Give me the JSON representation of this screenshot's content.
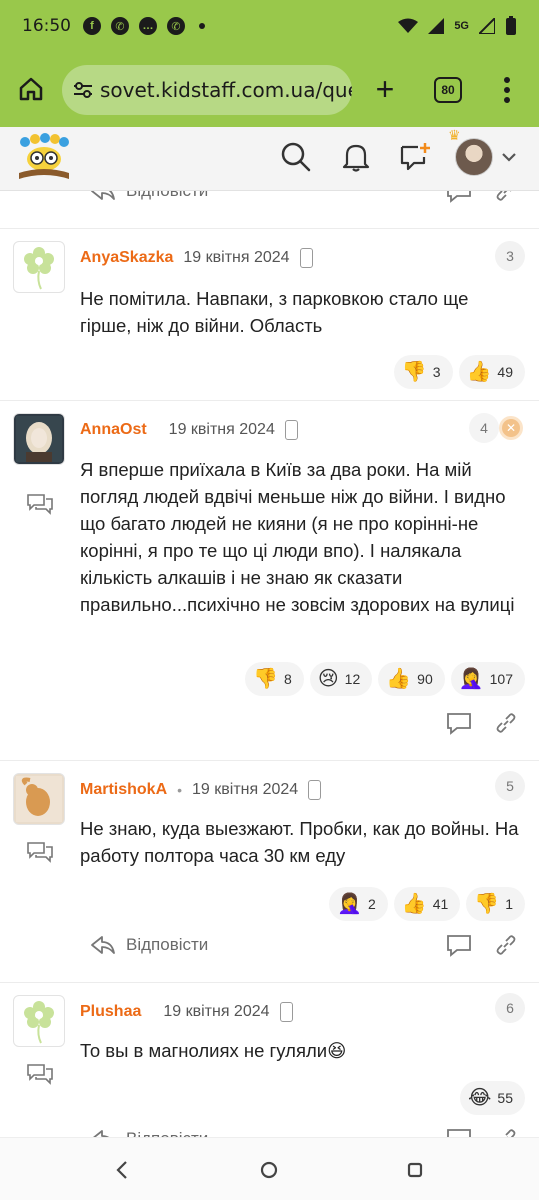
{
  "status": {
    "time": "16:50",
    "icons": [
      "facebook-icon",
      "whatsapp-icon",
      "chat-icon",
      "viber-icon"
    ],
    "network": "5G"
  },
  "browser": {
    "url": "sovet.kidstaff.com.ua/ques",
    "tab_count": "80"
  },
  "colors": {
    "chrome": "#99c84b",
    "username": "#ec6a16"
  },
  "reply_label": "Відповісти",
  "comments": [
    {
      "username": "AnyaSkazka",
      "date": "19 квітня 2024",
      "number": "3",
      "text": "Не помітила. Навпаки, з парковкою стало ще гірше, ніж до війни. Область",
      "reactions": [
        {
          "emoji": "👎",
          "count": "3"
        },
        {
          "emoji": "👍",
          "count": "49"
        }
      ]
    },
    {
      "username": "AnnaOst",
      "date": "19 квітня 2024",
      "number": "4",
      "text": "Я вперше приїхала в Київ за два роки. На мій погляд людей вдвічі меньше ніж до війни. І видно що багато людей не кияни (я не про корінні-не корінні, я про те що ці люди впо). І налякала кількість алкашів і не знаю як сказати правильно...психічно не зовсім здорових на вулиці",
      "reactions": [
        {
          "emoji": "👎",
          "count": "8"
        },
        {
          "emoji": "😢",
          "count": "12"
        },
        {
          "emoji": "👍",
          "count": "90"
        },
        {
          "emoji": "🤦‍♀️",
          "count": "107"
        }
      ]
    },
    {
      "username": "MartishokA",
      "date": "19 квітня 2024",
      "number": "5",
      "text": "Не знаю, куда выезжают. Пробки, как до войны. На работу полтора часа 30 км еду",
      "reactions": [
        {
          "emoji": "🤦‍♀️",
          "count": "2"
        },
        {
          "emoji": "👍",
          "count": "41"
        },
        {
          "emoji": "👎",
          "count": "1"
        }
      ]
    },
    {
      "username": "Plushaa",
      "date": "19 квітня 2024",
      "number": "6",
      "text": "То вы в магнолиях не гуляли😆",
      "reactions": [
        {
          "emoji": "😂",
          "count": "55"
        }
      ]
    }
  ]
}
